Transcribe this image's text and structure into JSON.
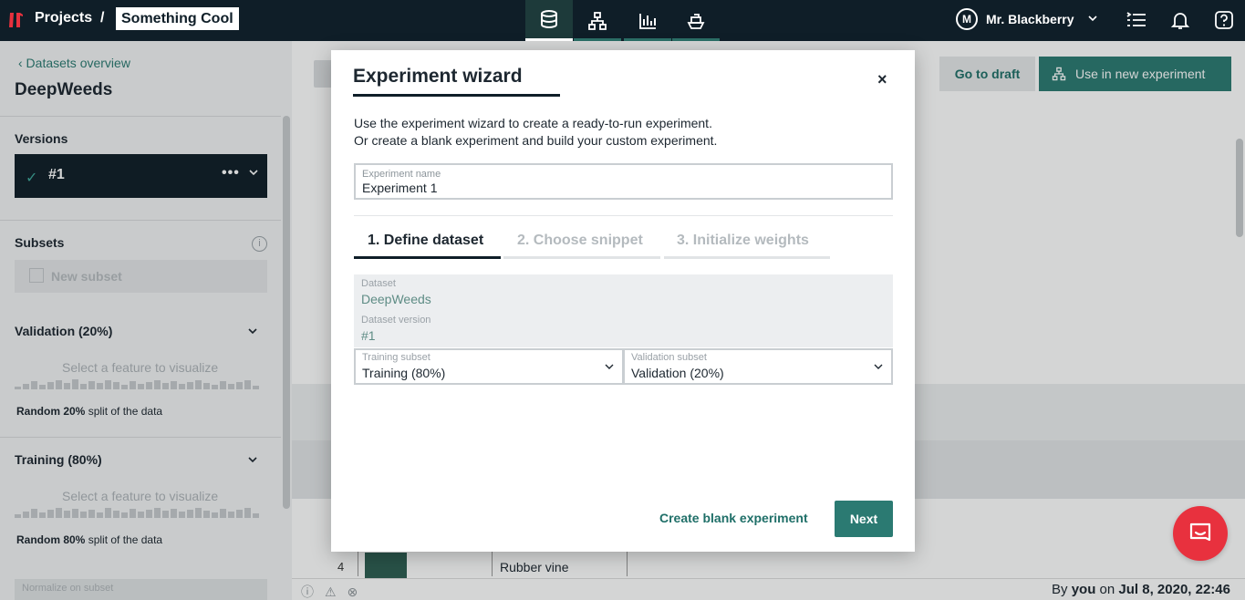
{
  "header": {
    "projects_label": "Projects",
    "separator": "/",
    "project_name": "Something Cool",
    "user_initial": "M",
    "user_name": "Mr. Blackberry",
    "nav_icons": [
      "database-icon",
      "model-hierarchy-icon",
      "bar-chart-icon",
      "deploy-ship-icon"
    ],
    "active_nav": "database-icon"
  },
  "sidebar": {
    "back_link": "‹  Datasets overview",
    "dataset_title": "DeepWeeds",
    "versions_label": "Versions",
    "version_value": "#1",
    "subsets_label": "Subsets",
    "new_subset_label": "New subset",
    "validation": {
      "title": "Validation (20%)",
      "placeholder": "Select a feature to visualize",
      "split_bold": "Random 20%",
      "split_rest": " split of the data"
    },
    "training": {
      "title": "Training (80%)",
      "placeholder": "Select a feature to visualize",
      "split_bold": "Random 80%",
      "split_rest": " split of the data"
    },
    "normalize_label": "Normalize on subset"
  },
  "main": {
    "goto_draft_label": "Go to draft",
    "use_new_label": "Use in new experiment",
    "row": {
      "index": "4",
      "label": "Rubber vine"
    },
    "footer": {
      "by": "By ",
      "user": "you",
      "on": " on ",
      "date": "Jul 8, 2020, 22:46"
    }
  },
  "modal": {
    "title": "Experiment wizard",
    "close": "×",
    "description_line1": "Use the experiment wizard to create a ready-to-run experiment.",
    "description_line2": "Or create a blank experiment and build your custom experiment.",
    "name_label": "Experiment name",
    "name_value": "Experiment 1",
    "steps": [
      "1. Define dataset",
      "2. Choose snippet",
      "3. Initialize weights"
    ],
    "active_step": 0,
    "dataset_label": "Dataset",
    "dataset_value": "DeepWeeds",
    "version_label": "Dataset version",
    "version_value": "#1",
    "training_label": "Training subset",
    "training_value": "Training (80%)",
    "validation_label": "Validation subset",
    "validation_value": "Validation (20%)",
    "blank_button": "Create blank experiment",
    "next_button": "Next"
  },
  "colors": {
    "topbar": "#0f1e28",
    "accent": "#2b7a72",
    "chat": "#e8313e"
  }
}
